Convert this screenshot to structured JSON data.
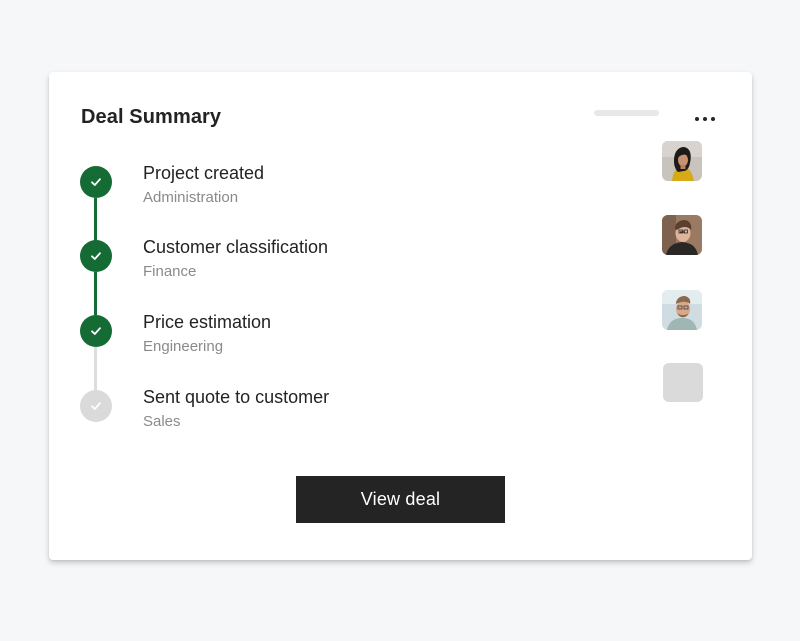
{
  "colors": {
    "done": "#146b34",
    "pending": "#dadada",
    "line_done": "#146b34",
    "line_pending": "#dddddd",
    "button_bg": "#242424"
  },
  "card": {
    "title": "Deal Summary",
    "menu_icon": "more-horizontal-icon"
  },
  "steps": [
    {
      "title": "Project created",
      "subtitle": "Administration",
      "status": "done",
      "avatar": "person-photo"
    },
    {
      "title": "Customer classification",
      "subtitle": "Finance",
      "status": "done",
      "avatar": "person-photo"
    },
    {
      "title": "Price estimation",
      "subtitle": "Engineering",
      "status": "done",
      "avatar": "person-photo"
    },
    {
      "title": "Sent quote to customer",
      "subtitle": "Sales",
      "status": "pending",
      "avatar": "avatar-placeholder"
    }
  ],
  "actions": {
    "view_label": "View deal"
  }
}
